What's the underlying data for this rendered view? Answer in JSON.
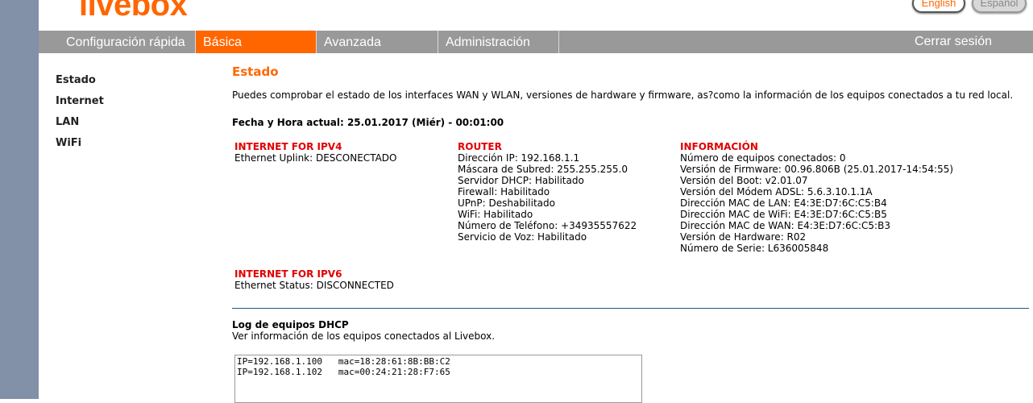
{
  "header": {
    "logo": "livebox",
    "lang_english": "English",
    "lang_spanish": "Español"
  },
  "nav": {
    "tabs": [
      "Configuración rápida",
      "Básica",
      "Avanzada",
      "Administración"
    ],
    "active_tab": "Básica",
    "logout": "Cerrar sesión"
  },
  "sidebar": {
    "items": [
      "Estado",
      "Internet",
      "LAN",
      "WiFi"
    ]
  },
  "main": {
    "title": "Estado",
    "intro": "Puedes comprobar el estado de los interfaces WAN y WLAN, versiones de hardware y firmware, as?como la información de los equipos conectados a tu red local.",
    "datetime": "Fecha y Hora actual: 25.01.2017 (Miér) - 00:01:00",
    "ipv4": {
      "header": "INTERNET FOR IPV4",
      "lines": [
        "Ethernet Uplink:  DESCONECTADO"
      ]
    },
    "router": {
      "header": "ROUTER",
      "lines": [
        "Dirección IP:  192.168.1.1",
        "Máscara de Subred:  255.255.255.0",
        "Servidor DHCP:  Habilitado",
        "Firewall:  Habilitado",
        "UPnP:  Deshabilitado",
        "WiFi:  Habilitado",
        "Número de Teléfono:  +34935557622",
        "Servicio de Voz:  Habilitado"
      ]
    },
    "info": {
      "header": "INFORMACIÓN",
      "lines": [
        "Número de equipos conectados:  0",
        "Versión de Firmware:  00.96.806B (25.01.2017-14:54:55)",
        "Versión del Boot:  v2.01.07",
        "Versión del Módem ADSL: 5.6.3.10.1.1A",
        "Dirección MAC de LAN: E4:3E:D7:6C:C5:B4",
        "Dirección MAC de WiFi: E4:3E:D7:6C:C5:B5",
        "Dirección MAC de WAN: E4:3E:D7:6C:C5:B3",
        "Versión de Hardware:  R02",
        "Número de Serie:   L636005848"
      ]
    },
    "ipv6": {
      "header": "INTERNET FOR IPV6",
      "lines": [
        "Ethernet Status:  DISCONNECTED"
      ]
    },
    "dhcp_log": {
      "title": "Log de equipos DHCP",
      "description": "Ver información de los equipos conectados al Livebox.",
      "entries": [
        "IP=192.168.1.100   mac=18:28:61:8B:BB:C2",
        "IP=192.168.1.102   mac=00:24:21:28:F7:65"
      ]
    }
  },
  "colors": {
    "brand_orange": "#ff6600",
    "nav_gray": "#999999",
    "section_red": "#e00000",
    "left_strip": "#8290a8"
  }
}
